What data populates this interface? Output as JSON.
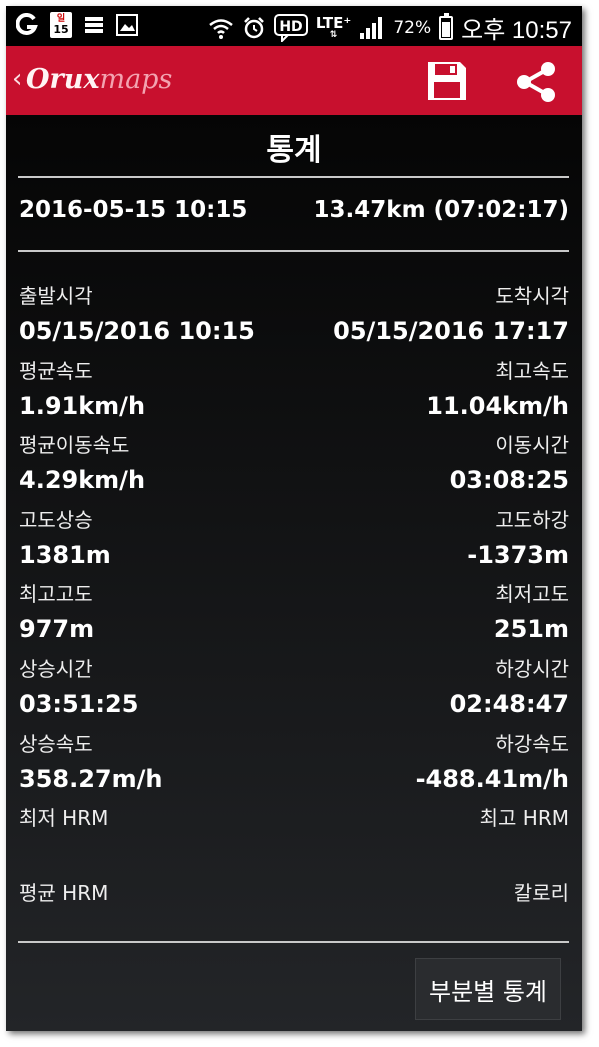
{
  "status_bar": {
    "calendar_top": "일",
    "calendar_day": "15",
    "hd": "HD",
    "lte": "LTE⁺",
    "battery_percent": "72%",
    "time": "오후 10:57",
    "icons": [
      "g-icon",
      "calendar-icon",
      "storage-icon",
      "image-icon",
      "wifi-icon",
      "alarm-icon",
      "hd-voice-icon",
      "lte-icon",
      "signal-icon",
      "battery-charging-icon"
    ]
  },
  "app_bar": {
    "back_glyph": "‹",
    "logo_part1": "Orux",
    "logo_part2": "maps",
    "actions": [
      "save-icon",
      "share-icon"
    ],
    "color": "#c8102e"
  },
  "page": {
    "title": "통계",
    "summary_date": "2016-05-15 10:15",
    "summary_distance": "13.47km (07:02:17)"
  },
  "stats": [
    {
      "left_label": "출발시각",
      "left_value": "05/15/2016 10:15",
      "right_label": "도착시각",
      "right_value": "05/15/2016 17:17"
    },
    {
      "left_label": "평균속도",
      "left_value": "1.91km/h",
      "right_label": "최고속도",
      "right_value": "11.04km/h"
    },
    {
      "left_label": "평균이동속도",
      "left_value": "4.29km/h",
      "right_label": "이동시간",
      "right_value": "03:08:25"
    },
    {
      "left_label": "고도상승",
      "left_value": "1381m",
      "right_label": "고도하강",
      "right_value": "-1373m"
    },
    {
      "left_label": "최고고도",
      "left_value": "977m",
      "right_label": "최저고도",
      "right_value": "251m"
    },
    {
      "left_label": "상승시간",
      "left_value": "03:51:25",
      "right_label": "하강시간",
      "right_value": "02:48:47"
    },
    {
      "left_label": "상승속도",
      "left_value": "358.27m/h",
      "right_label": "하강속도",
      "right_value": "-488.41m/h"
    },
    {
      "left_label": "최저 HRM",
      "left_value": "",
      "right_label": "최고 HRM",
      "right_value": ""
    },
    {
      "left_label": "평균 HRM",
      "left_value": "",
      "right_label": "칼로리",
      "right_value": ""
    }
  ],
  "buttons": {
    "segment_stats": "부분별 통계"
  }
}
